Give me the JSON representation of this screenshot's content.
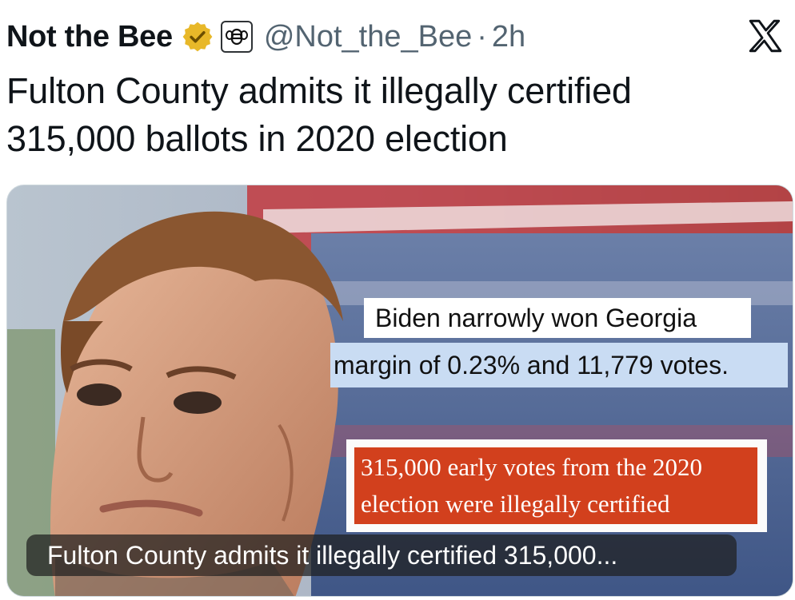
{
  "post": {
    "author_name": "Not the Bee",
    "handle": "@Not_the_Bee",
    "separator": "·",
    "time": "2h",
    "text_line1": "Fulton County admits it illegally certified",
    "text_line2": "315,000 ballots in 2020 election"
  },
  "icons": {
    "verified": "verified-gold-badge-icon",
    "org": "bee-logo-icon",
    "platform": "x-logo-icon"
  },
  "media": {
    "headline_box_1": "Biden narrowly won Georgia",
    "headline_box_2": "margin of 0.23% and 11,779 votes.",
    "headline_box_3_line1": "315,000 early votes from the 2020",
    "headline_box_3_line2": "election were illegally certified",
    "link_caption": "Fulton County admits it illegally certified 315,000..."
  },
  "colors": {
    "verified_gold": "#e8b829",
    "highlight_blue": "#c9dcf3",
    "highlight_red": "#d2401d",
    "secondary_text": "#536471"
  }
}
